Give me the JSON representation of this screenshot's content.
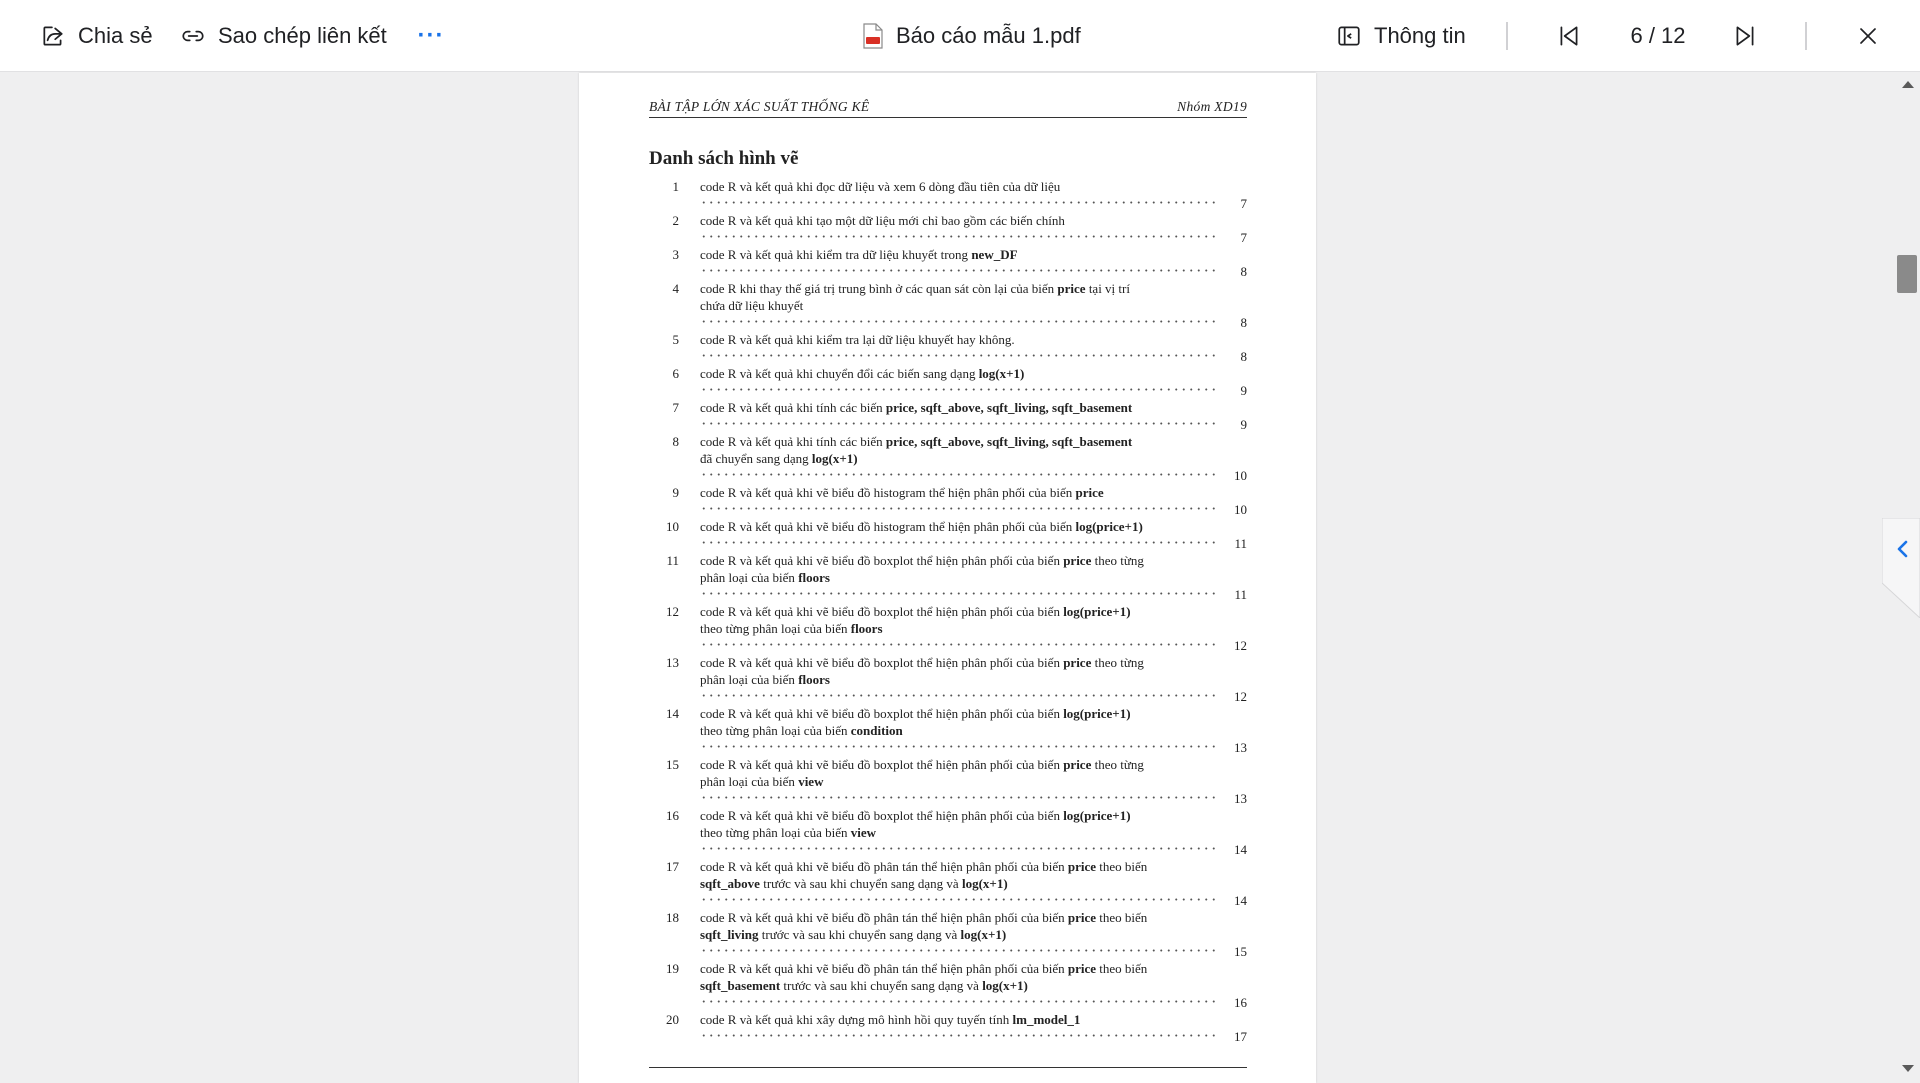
{
  "toolbar": {
    "share_label": "Chia sẻ",
    "copy_link_label": "Sao chép liên kết",
    "more_label": "···",
    "file_name": "Báo cáo mẫu 1.pdf",
    "info_label": "Thông tin",
    "page_indicator": "6 / 12"
  },
  "page": {
    "header_left": "BÀI TẬP LỚN XÁC SUẤT THỐNG KÊ",
    "header_right": "Nhóm XD19",
    "list_title": "Danh sách hình vẽ",
    "entries": [
      {
        "num": "1",
        "page": "7",
        "lines": [
          [
            [
              "code R và kết quả khi đọc dữ liệu và xem 6 dòng đầu tiên của dữ liệu",
              false
            ]
          ]
        ]
      },
      {
        "num": "2",
        "page": "7",
        "lines": [
          [
            [
              "code R và kết quả khi tạo một dữ liệu mới chỉ bao gồm các biến chính",
              false
            ]
          ]
        ]
      },
      {
        "num": "3",
        "page": "8",
        "lines": [
          [
            [
              "code R và kết quả khi kiểm tra dữ liệu khuyết trong ",
              false
            ],
            [
              "new_DF",
              true
            ]
          ]
        ]
      },
      {
        "num": "4",
        "page": "8",
        "lines": [
          [
            [
              "code R khi thay thế giá trị trung bình ở các quan sát còn lại của biến ",
              false
            ],
            [
              "price",
              true
            ],
            [
              " tại vị trí",
              false
            ]
          ],
          [
            [
              "chứa dữ liệu khuyết",
              false
            ]
          ]
        ]
      },
      {
        "num": "5",
        "page": "8",
        "lines": [
          [
            [
              "code R và kết quả khi kiểm tra lại dữ liệu khuyết hay không.",
              false
            ]
          ]
        ]
      },
      {
        "num": "6",
        "page": "9",
        "lines": [
          [
            [
              "code R và kết quả khi chuyển đổi các biến sang dạng ",
              false
            ],
            [
              "log(x+1)",
              true
            ]
          ]
        ]
      },
      {
        "num": "7",
        "page": "9",
        "lines": [
          [
            [
              "code R và kết quả khi tính các biến ",
              false
            ],
            [
              "price, sqft_above, sqft_living, sqft_basement",
              true
            ]
          ]
        ]
      },
      {
        "num": "8",
        "page": "10",
        "lines": [
          [
            [
              "code R và kết quả khi tính các biến ",
              false
            ],
            [
              "price, sqft_above, sqft_living, sqft_basement",
              true
            ]
          ],
          [
            [
              "đã chuyển sang dạng ",
              false
            ],
            [
              "log(x+1)",
              true
            ]
          ]
        ]
      },
      {
        "num": "9",
        "page": "10",
        "lines": [
          [
            [
              "code R và kết quả khi vẽ biểu đồ histogram thể hiện phân phối của biến ",
              false
            ],
            [
              "price",
              true
            ]
          ]
        ]
      },
      {
        "num": "10",
        "page": "11",
        "lines": [
          [
            [
              "code R và kết quả khi vẽ biểu đồ histogram thể hiện phân phối của biến ",
              false
            ],
            [
              "log(price+1)",
              true
            ]
          ]
        ]
      },
      {
        "num": "11",
        "page": "11",
        "lines": [
          [
            [
              "code R và kết quả khi vẽ biểu đồ boxplot thể hiện phân phối của biến ",
              false
            ],
            [
              "price",
              true
            ],
            [
              " theo từng",
              false
            ]
          ],
          [
            [
              "phân loại của biến ",
              false
            ],
            [
              "floors",
              true
            ]
          ]
        ]
      },
      {
        "num": "12",
        "page": "12",
        "lines": [
          [
            [
              "code R và kết quả khi vẽ biểu đồ boxplot thể hiện phân phối của biến ",
              false
            ],
            [
              "log(price+1)",
              true
            ]
          ],
          [
            [
              "theo từng phân loại của biến ",
              false
            ],
            [
              "floors",
              true
            ]
          ]
        ]
      },
      {
        "num": "13",
        "page": "12",
        "lines": [
          [
            [
              "code R và kết quả khi vẽ biểu đồ boxplot thể hiện phân phối của biến ",
              false
            ],
            [
              "price",
              true
            ],
            [
              " theo từng",
              false
            ]
          ],
          [
            [
              "phân loại của biến ",
              false
            ],
            [
              "floors",
              true
            ]
          ]
        ]
      },
      {
        "num": "14",
        "page": "13",
        "lines": [
          [
            [
              "code R và kết quả khi vẽ biểu đồ boxplot thể hiện phân phối của biến ",
              false
            ],
            [
              "log(price+1)",
              true
            ]
          ],
          [
            [
              "theo từng phân loại của biến ",
              false
            ],
            [
              "condition",
              true
            ]
          ]
        ]
      },
      {
        "num": "15",
        "page": "13",
        "lines": [
          [
            [
              "code R và kết quả khi vẽ biểu đồ boxplot thể hiện phân phối của biến ",
              false
            ],
            [
              "price",
              true
            ],
            [
              " theo từng",
              false
            ]
          ],
          [
            [
              "phân loại của biến ",
              false
            ],
            [
              "view",
              true
            ]
          ]
        ]
      },
      {
        "num": "16",
        "page": "14",
        "lines": [
          [
            [
              "code R và kết quả khi vẽ biểu đồ boxplot thể hiện phân phối của biến ",
              false
            ],
            [
              "log(price+1)",
              true
            ]
          ],
          [
            [
              "theo từng phân loại của biến ",
              false
            ],
            [
              "view",
              true
            ]
          ]
        ]
      },
      {
        "num": "17",
        "page": "14",
        "lines": [
          [
            [
              "code R và kết quả khi vẽ biểu đồ phân tán thể hiện phân phối của biến ",
              false
            ],
            [
              "price",
              true
            ],
            [
              " theo biến",
              false
            ]
          ],
          [
            [
              "sqft_above",
              true
            ],
            [
              " trước và sau khi chuyển sang dạng và ",
              false
            ],
            [
              "log(x+1)",
              true
            ]
          ]
        ]
      },
      {
        "num": "18",
        "page": "15",
        "lines": [
          [
            [
              "code R và kết quả khi vẽ biểu đồ phân tán thể hiện phân phối của biến ",
              false
            ],
            [
              "price",
              true
            ],
            [
              " theo biến",
              false
            ]
          ],
          [
            [
              "sqft_living",
              true
            ],
            [
              " trước và sau khi chuyển sang dạng và ",
              false
            ],
            [
              "log(x+1)",
              true
            ]
          ]
        ]
      },
      {
        "num": "19",
        "page": "16",
        "lines": [
          [
            [
              "code R và kết quả khi vẽ biểu đồ phân tán thể hiện phân phối của biến ",
              false
            ],
            [
              "price",
              true
            ],
            [
              " theo biến",
              false
            ]
          ],
          [
            [
              "sqft_basement",
              true
            ],
            [
              " trước và sau khi chuyển sang dạng và ",
              false
            ],
            [
              "log(x+1)",
              true
            ]
          ]
        ]
      },
      {
        "num": "20",
        "page": "17",
        "lines": [
          [
            [
              "code R và kết quả khi xây dựng mô hình hồi quy tuyến tính ",
              false
            ],
            [
              "lm_model_1",
              true
            ]
          ]
        ]
      }
    ]
  },
  "icons": {
    "share": "share-icon",
    "link": "link-icon",
    "pdf": "pdf-file-icon",
    "info": "info-panel-icon",
    "first_page": "first-page-icon",
    "last_page": "last-page-icon",
    "close": "close-icon",
    "side_panel": "chevron-left-icon"
  },
  "colors": {
    "accent": "#1a73e8",
    "pdf_red": "#d93025"
  }
}
